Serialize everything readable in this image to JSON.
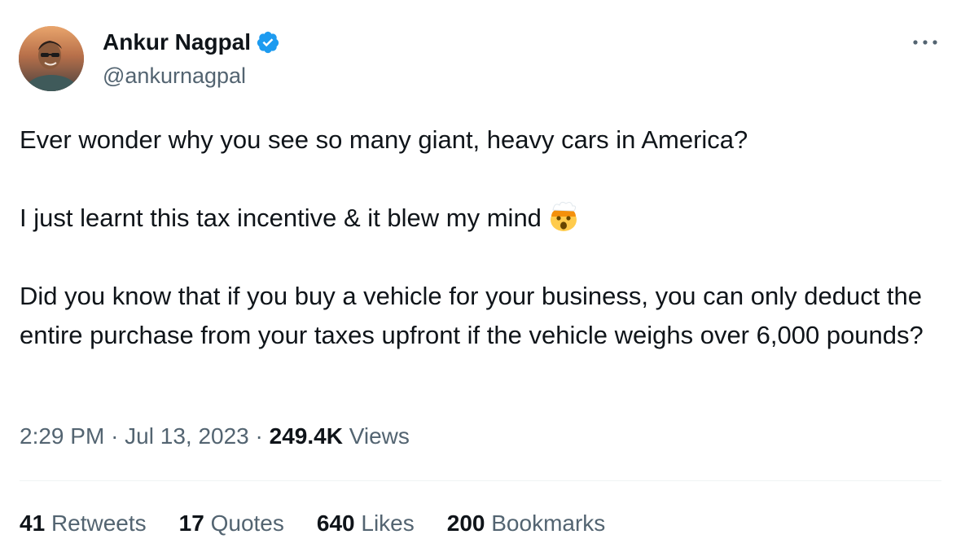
{
  "author": {
    "display_name": "Ankur Nagpal",
    "handle": "@ankurnagpal",
    "avatar_icon": "profile-photo",
    "verified_icon": "verified-badge-icon",
    "verified_color": "#1d9bf0"
  },
  "tweet": {
    "paragraphs": [
      "Ever wonder why you see so many giant, heavy cars in America?",
      "I just learnt this tax incentive & it blew my mind",
      "Did you know that if you buy a vehicle for your business, you can only deduct the entire purchase from your taxes upfront if the vehicle weighs over 6,000 pounds?"
    ],
    "emoji_icon": "exploding-head-emoji-icon",
    "time": "2:29 PM",
    "separator": "·",
    "date": "Jul 13, 2023",
    "views_count": "249.4K",
    "views_label": "Views"
  },
  "stats": [
    {
      "count": "41",
      "label": "Retweets"
    },
    {
      "count": "17",
      "label": "Quotes"
    },
    {
      "count": "640",
      "label": "Likes"
    },
    {
      "count": "200",
      "label": "Bookmarks"
    }
  ],
  "colors": {
    "text_primary": "#0f1419",
    "text_secondary": "#536471",
    "divider": "#eff3f4",
    "accent": "#1d9bf0"
  },
  "more_icon": "more-options-icon"
}
